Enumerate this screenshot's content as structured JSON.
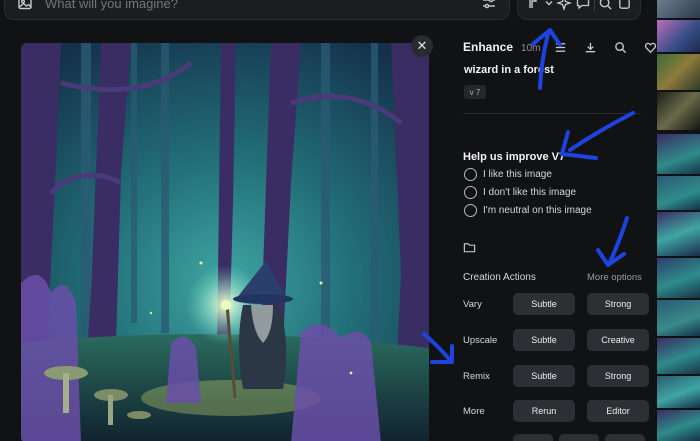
{
  "search": {
    "placeholder": "What will you imagine?"
  },
  "toolbar": {
    "icons": [
      "image-icon",
      "tune-icon",
      "brush-icon",
      "chevron-down-icon",
      "sparkle-icon",
      "chat-icon",
      "search-icon",
      "expand-icon"
    ]
  },
  "detail": {
    "title": "Enhance",
    "time": "10m",
    "prompt": "wizard in a forest",
    "version": "v 7",
    "feedback": {
      "title": "Help us improve V7",
      "options": [
        "I like this image",
        "I don't like this image",
        "I'm neutral on this image"
      ]
    },
    "actions": {
      "title": "Creation Actions",
      "more_options": "More options",
      "rows": [
        {
          "label": "Vary",
          "buttons": [
            "Subtle",
            "Strong"
          ]
        },
        {
          "label": "Upscale",
          "buttons": [
            "Subtle",
            "Creative"
          ]
        },
        {
          "label": "Remix",
          "buttons": [
            "Subtle",
            "Strong"
          ]
        },
        {
          "label": "More",
          "buttons": [
            "Rerun",
            "Editor"
          ]
        }
      ]
    }
  },
  "colors": {
    "background": "#111214",
    "panel": "#1c1d21",
    "button": "#2e2f34",
    "annotation_arrow": "#1d43e0",
    "forest_teal": "#2f8c8a",
    "wizard_glow": "#d8f06a"
  }
}
